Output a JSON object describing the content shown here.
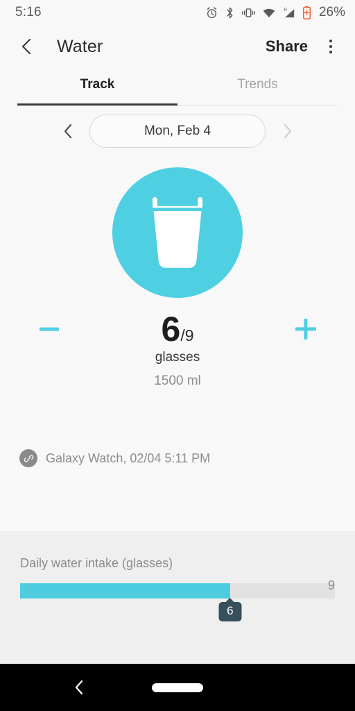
{
  "statusbar": {
    "time": "5:16",
    "battery_percent": "26%",
    "icons": [
      "alarm-icon",
      "bluetooth-icon",
      "vibrate-icon",
      "wifi-icon",
      "signal-roaming-icon",
      "battery-low-icon"
    ],
    "roaming_label": "R",
    "battery_color": "#f4622d",
    "text_color": "#5a5a5a"
  },
  "appbar": {
    "back_icon": "chevron-left-icon",
    "title": "Water",
    "share_label": "Share",
    "overflow_icon": "more-vertical-icon"
  },
  "tabs": [
    {
      "label": "Track",
      "active": true
    },
    {
      "label": "Trends",
      "active": false
    }
  ],
  "date_selector": {
    "prev_icon": "chevron-left-icon",
    "next_icon": "chevron-right-icon",
    "date": "Mon, Feb 4",
    "prev_enabled": "true",
    "next_enabled": "false"
  },
  "hero": {
    "icon": "water-glass-icon",
    "circle_color": "#4fcfe2",
    "glass_color": "#ffffff"
  },
  "counter": {
    "decrement_icon": "minus-icon",
    "increment_icon": "plus-icon",
    "value": "6",
    "goal": "/9",
    "unit": "glasses",
    "volume": "1500 ml",
    "accent_color": "#4fcfe2"
  },
  "source": {
    "badge_icon": "link-icon",
    "text": "Galaxy Watch, 02/04 5:11 PM"
  },
  "chart_data": {
    "type": "bar",
    "title": "Daily water intake (glasses)",
    "categories": [
      "intake"
    ],
    "values": [
      6
    ],
    "max_label": "9",
    "value_label": "6",
    "ylim": [
      0,
      9
    ],
    "fill_color": "#4fcde0",
    "track_color": "#e2e2e2",
    "tooltip_color": "#36505c",
    "fill_percent": 66.7,
    "grid": false,
    "legend": "none",
    "xlabel": "",
    "ylabel": "glasses"
  },
  "navbar": {
    "back_icon": "nav-back-icon",
    "home_icon": "nav-home-pill"
  }
}
